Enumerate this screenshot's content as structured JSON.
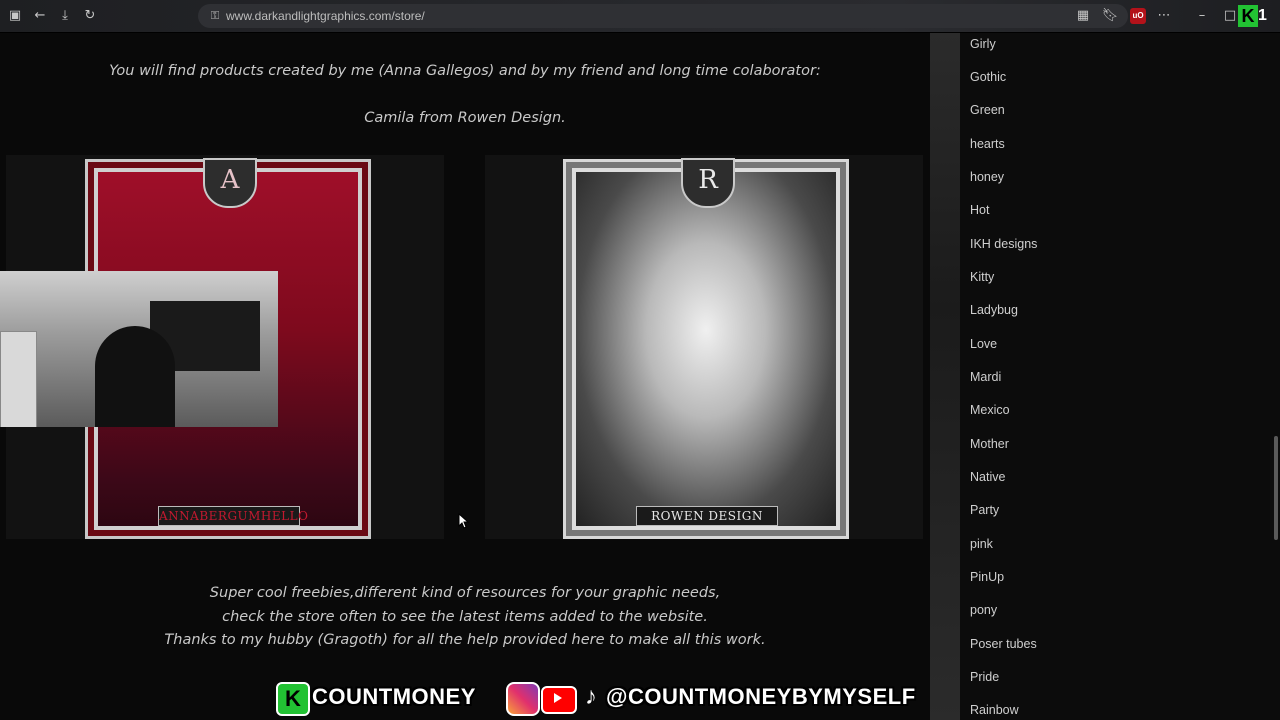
{
  "browser": {
    "url": "www.darkandlightgraphics.com/store/",
    "icons": [
      "sidebar-icon",
      "back-icon",
      "download-icon",
      "refresh-icon",
      "lock-icon",
      "reader-icon",
      "bookmark-icon",
      "ublock-icon",
      "more-icon",
      "minimize-icon",
      "restore-icon",
      "close-icon"
    ],
    "ublock_label": "uO",
    "extension_badge": {
      "letter": "K",
      "text": "1"
    }
  },
  "main": {
    "intro_line": "You will find products created by me (Anna Gallegos) and by my friend and long time colaborator:",
    "intro_line_2": "Camila from Rowen Design.",
    "frames": [
      {
        "letter": "A",
        "nameplate": "ANNABERGUMHELLO"
      },
      {
        "letter": "R",
        "nameplate": "ROWEN DESIGN"
      }
    ],
    "outro": [
      "Super cool freebies,different kind of resources for your graphic needs,",
      "check the store often to see the latest items added to the website.",
      "Thanks to my hubby (Gragoth) for all the help provided here to make all this work."
    ]
  },
  "sidebar": {
    "tags": [
      "Girly",
      "Gothic",
      "Green",
      "hearts",
      "honey",
      "Hot",
      "IKH designs",
      "Kitty",
      "Ladybug",
      "Love",
      "Mardi",
      "Mexico",
      "Mother",
      "Native",
      "Party",
      "pink",
      "PinUp",
      "pony",
      "Poser tubes",
      "Pride",
      "Rainbow"
    ]
  },
  "overlay": {
    "k_letter": "K",
    "name": "COUNTMONEY",
    "handle": "@COUNTMONEYBYMYSELF"
  }
}
